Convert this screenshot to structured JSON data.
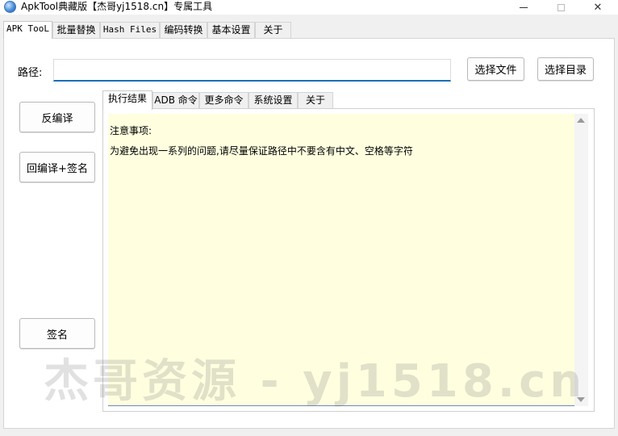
{
  "window": {
    "title": "ApkTool典藏版【杰哥yj1518.cn】专属工具",
    "controls": {
      "minimize_icon": "minimize-icon",
      "maximize_icon": "maximize-icon",
      "close_icon": "close-icon"
    }
  },
  "main_tabs": [
    {
      "label": "APK TooL"
    },
    {
      "label": "批量替换"
    },
    {
      "label": "Hash Files"
    },
    {
      "label": "编码转换"
    },
    {
      "label": "基本设置"
    },
    {
      "label": "关于"
    }
  ],
  "path": {
    "label": "路径:",
    "value": "",
    "placeholder": ""
  },
  "buttons": {
    "choose_file": "选择文件",
    "choose_dir": "选择目录",
    "decompile": "反编译",
    "recompile_sign": "回编译+签名",
    "sign": "签名"
  },
  "sub_tabs": [
    {
      "label": "执行结果"
    },
    {
      "label": "ADB 命令"
    },
    {
      "label": "更多命令"
    },
    {
      "label": "系统设置"
    },
    {
      "label": "关于"
    }
  ],
  "output": {
    "lines": [
      "注意事项:",
      "为避免出现一系列的问题,请尽量保证路径中不要含有中文、空格等字符"
    ]
  },
  "watermark": "杰哥资源 - yj1518.cn",
  "colors": {
    "output_background": "#ffffe0",
    "input_underline": "#1b6dbb"
  }
}
